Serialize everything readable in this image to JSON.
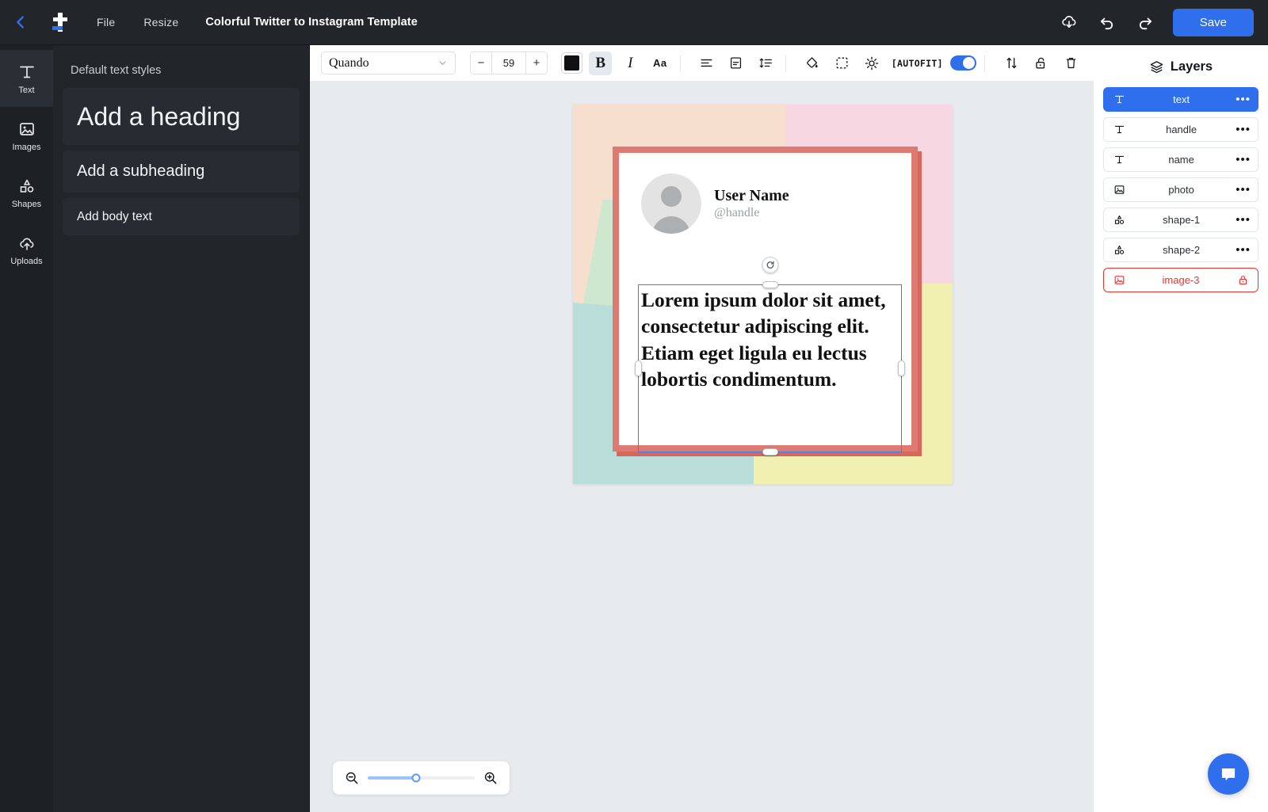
{
  "header": {
    "back_icon": "chevron-left-icon",
    "logo_icon": "app-logo-t-icon",
    "menus": [
      {
        "label": "File",
        "name": "file-menu"
      },
      {
        "label": "Resize",
        "name": "resize-menu"
      }
    ],
    "doc_title": "Colorful Twitter to Instagram Template",
    "actions": [
      {
        "name": "download-icon",
        "label": "download-cloud-icon"
      },
      {
        "name": "undo-icon",
        "label": "undo-icon"
      },
      {
        "name": "redo-icon",
        "label": "redo-icon"
      }
    ],
    "save_label": "Save",
    "accent_blue": "#2f6fed",
    "bar_bg": "#22262b"
  },
  "rail": {
    "items": [
      {
        "label": "Text",
        "icon": "text-icon",
        "active": true
      },
      {
        "label": "Images",
        "icon": "image-icon",
        "active": false
      },
      {
        "label": "Shapes",
        "icon": "shapes-icon",
        "active": false
      },
      {
        "label": "Uploads",
        "icon": "upload-cloud-icon",
        "active": false
      }
    ]
  },
  "panel": {
    "title": "Default text styles",
    "styles": [
      {
        "label": "Add a heading"
      },
      {
        "label": "Add a subheading"
      },
      {
        "label": "Add body text"
      }
    ]
  },
  "toolbar": {
    "font_family": "Quando",
    "font_size": "59",
    "decrease_label": "−",
    "increase_label": "+",
    "text_color": "#111111",
    "bold_label": "B",
    "italic_label": "I",
    "case_label": "Aa",
    "autofit_label": "[AUTOFIT]",
    "autofit_on": true,
    "icons": [
      "align-left-icon",
      "vertical-align-icon",
      "line-height-icon",
      "fill-bucket-icon",
      "selection-icon",
      "brightness-icon",
      "arrange-icon",
      "unlock-icon",
      "trash-icon"
    ]
  },
  "canvas": {
    "background": "#e8ebee",
    "artboard_colors": {
      "peach": "#f6e0cd",
      "pink": "#f7d7e2",
      "green": "#cde8cf",
      "teal": "#b9ddd8",
      "yellow": "#f2f0b0"
    },
    "card": {
      "border_color": "#dd7a71",
      "shadow_color": "#d7675d",
      "user_name": "User Name",
      "handle": "@handle",
      "body_text": "Lorem ipsum dolor sit amet, consectetur adipiscing elit. Etiam eget ligula eu lectus lobortis condimentum."
    },
    "selection": {
      "color": "#3b7df0",
      "rotate_icon": "rotate-icon"
    },
    "zoom": {
      "out_icon": "zoom-out-icon",
      "in_icon": "zoom-in-icon",
      "value_percent": "45"
    }
  },
  "layers": {
    "title": "Layers",
    "title_icon": "layers-icon",
    "rows": [
      {
        "name": "text",
        "icon": "text-layer-icon",
        "state": "selected",
        "menu": "•••"
      },
      {
        "name": "handle",
        "icon": "text-layer-icon",
        "state": "normal",
        "menu": "•••"
      },
      {
        "name": "name",
        "icon": "text-layer-icon",
        "state": "normal",
        "menu": "•••"
      },
      {
        "name": "photo",
        "icon": "image-layer-icon",
        "state": "normal",
        "menu": "•••"
      },
      {
        "name": "shape-1",
        "icon": "shape-layer-icon",
        "state": "normal",
        "menu": "•••"
      },
      {
        "name": "shape-2",
        "icon": "shape-layer-icon",
        "state": "normal",
        "menu": "•••"
      },
      {
        "name": "image-3",
        "icon": "image-layer-icon",
        "state": "locked",
        "menu": "lock-icon"
      }
    ],
    "selected_color": "#2f6fed",
    "locked_color": "#e8332f"
  },
  "chat": {
    "icon": "chat-bubble-icon"
  }
}
